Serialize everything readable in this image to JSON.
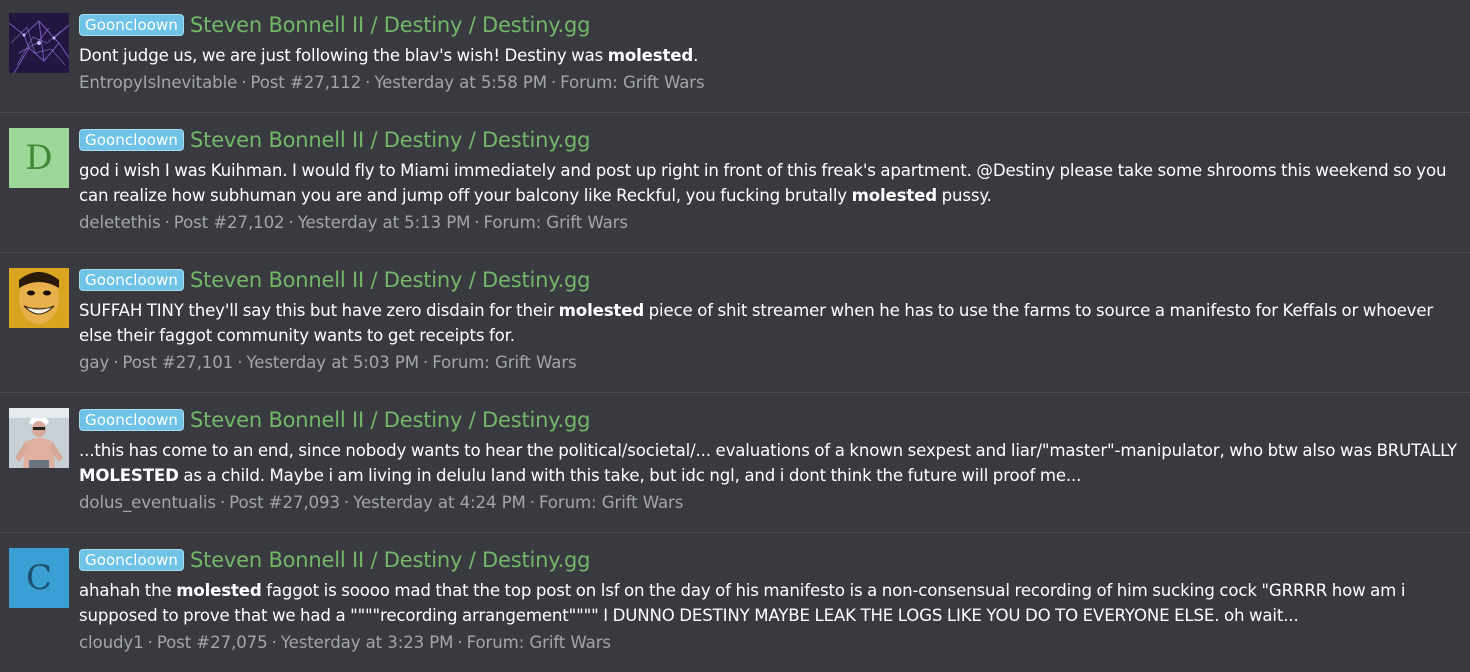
{
  "results": [
    {
      "label": "Gooncloown",
      "thread_title": "Steven Bonnell II / Destiny / Destiny.gg",
      "snippet_before": "Dont judge us, we are just following the blav's wish! Destiny was ",
      "highlight": "molested",
      "snippet_after": ".",
      "author": "EntropyIsInevitable",
      "post": "Post #27,112",
      "time": "Yesterday at 5:58 PM",
      "forum": "Forum: Grift Wars",
      "avatar": {
        "type": "image",
        "desc": "purple-network-avatar",
        "bg": "#2a1d4a"
      }
    },
    {
      "label": "Gooncloown",
      "thread_title": "Steven Bonnell II / Destiny / Destiny.gg",
      "snippet_before": "god i wish I was Kuihman. I would fly to Miami immediately and post up right in front of this freak's apartment. @Destiny please take some shrooms this weekend so you can realize how subhuman you are and jump off your balcony like Reckful, you fucking brutally ",
      "highlight": "molested",
      "snippet_after": " pussy.",
      "author": "deletethis",
      "post": "Post #27,102",
      "time": "Yesterday at 5:13 PM",
      "forum": "Forum: Grift Wars",
      "avatar": {
        "type": "letter",
        "letter": "D",
        "bg": "#9ed79a",
        "fg": "#3e8a36"
      }
    },
    {
      "label": "Gooncloown",
      "thread_title": "Steven Bonnell II / Destiny / Destiny.gg",
      "snippet_before": "SUFFAH TINY they'll say this but have zero disdain for their ",
      "highlight": "molested",
      "snippet_after": " piece of shit streamer when he has to use the farms to source a manifesto for Keffals or whoever else their faggot community wants to get receipts for.",
      "author": "gay",
      "post": "Post #27,101",
      "time": "Yesterday at 5:03 PM",
      "forum": "Forum: Grift Wars",
      "avatar": {
        "type": "image",
        "desc": "grinning-face-avatar",
        "bg": "#d9a520"
      }
    },
    {
      "label": "Gooncloown",
      "thread_title": "Steven Bonnell II / Destiny / Destiny.gg",
      "snippet_before": "...this has come to an end, since nobody wants to hear the political/societal/... evaluations of a known sexpest and liar/\"master\"-manipulator, who btw also was BRUTALLY ",
      "highlight": "MOLESTED",
      "snippet_after": " as a child. Maybe i am living in delulu land with this take, but idc ngl, and i dont think the future will proof me...",
      "author": "dolus_eventualis",
      "post": "Post #27,093",
      "time": "Yesterday at 4:24 PM",
      "forum": "Forum: Grift Wars",
      "avatar": {
        "type": "image",
        "desc": "shirtless-man-avatar",
        "bg": "#b9c4cc"
      }
    },
    {
      "label": "Gooncloown",
      "thread_title": "Steven Bonnell II / Destiny / Destiny.gg",
      "snippet_before": "ahahah the ",
      "highlight": "molested",
      "snippet_after": " faggot is soooo mad that the top post on lsf on the day of his manifesto is a non-consensual recording of him sucking cock \"GRRRR how am i supposed to prove that we had a \"\"\"\"recording arrangement\"\"\"\" I DUNNO DESTINY MAYBE LEAK THE LOGS LIKE YOU DO TO EVERYONE ELSE. oh wait...",
      "author": "cloudy1",
      "post": "Post #27,075",
      "time": "Yesterday at 3:23 PM",
      "forum": "Forum: Grift Wars",
      "avatar": {
        "type": "letter",
        "letter": "C",
        "bg": "#3a9fd4",
        "fg": "#1d4f6e"
      }
    }
  ],
  "separator": "·"
}
